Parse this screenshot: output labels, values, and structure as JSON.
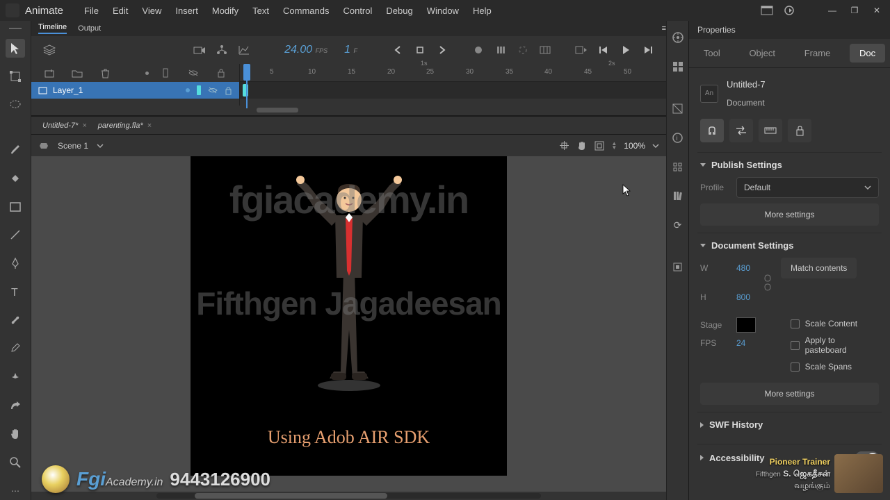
{
  "app": {
    "name": "Animate"
  },
  "menu": [
    "File",
    "Edit",
    "View",
    "Insert",
    "Modify",
    "Text",
    "Commands",
    "Control",
    "Debug",
    "Window",
    "Help"
  ],
  "timeline": {
    "tabTimeline": "Timeline",
    "tabOutput": "Output",
    "fps": "24.00",
    "fpsLabel": "FPS",
    "frame": "1",
    "frameLabel": "F",
    "layer": "Layer_1",
    "ruler": {
      "s1": "1s",
      "s2": "2s",
      "marks": [
        "5",
        "10",
        "15",
        "20",
        "25",
        "30",
        "35",
        "40",
        "45",
        "50"
      ]
    }
  },
  "docs": {
    "tab1": "Untitled-7*",
    "tab2": "parenting.fla*"
  },
  "scene": {
    "name": "Scene 1",
    "zoom": "100%"
  },
  "stage": {
    "caption": "Using Adob AIR SDK",
    "wm1": "fgiacademy.in",
    "wm2": "Fifthgen Jagadeesan"
  },
  "overlay": {
    "phone": "9443126900",
    "logoText": "Fgi",
    "logoSuffix": "Academy.in",
    "cornerLine1": "Pioneer Trainer",
    "cornerLine2": "S. ஜெகதீசன்",
    "cornerLine3": "வழங்கும்",
    "cornerPrefix": "Fifthgen"
  },
  "props": {
    "title": "Properties",
    "tabs": {
      "tool": "Tool",
      "object": "Object",
      "frame": "Frame",
      "doc": "Doc"
    },
    "docName": "Untitled-7",
    "docType": "Document",
    "publish": {
      "title": "Publish Settings",
      "profileLabel": "Profile",
      "profile": "Default",
      "more": "More settings"
    },
    "docset": {
      "title": "Document Settings",
      "wLabel": "W",
      "w": "480",
      "hLabel": "H",
      "h": "800",
      "match": "Match contents",
      "stageLabel": "Stage",
      "fpsLabel": "FPS",
      "fps": "24",
      "scaleContent": "Scale Content",
      "applyPaste": "Apply to pasteboard",
      "scaleSpans": "Scale Spans",
      "more": "More settings"
    },
    "swf": "SWF History",
    "acc": "Accessibility"
  }
}
